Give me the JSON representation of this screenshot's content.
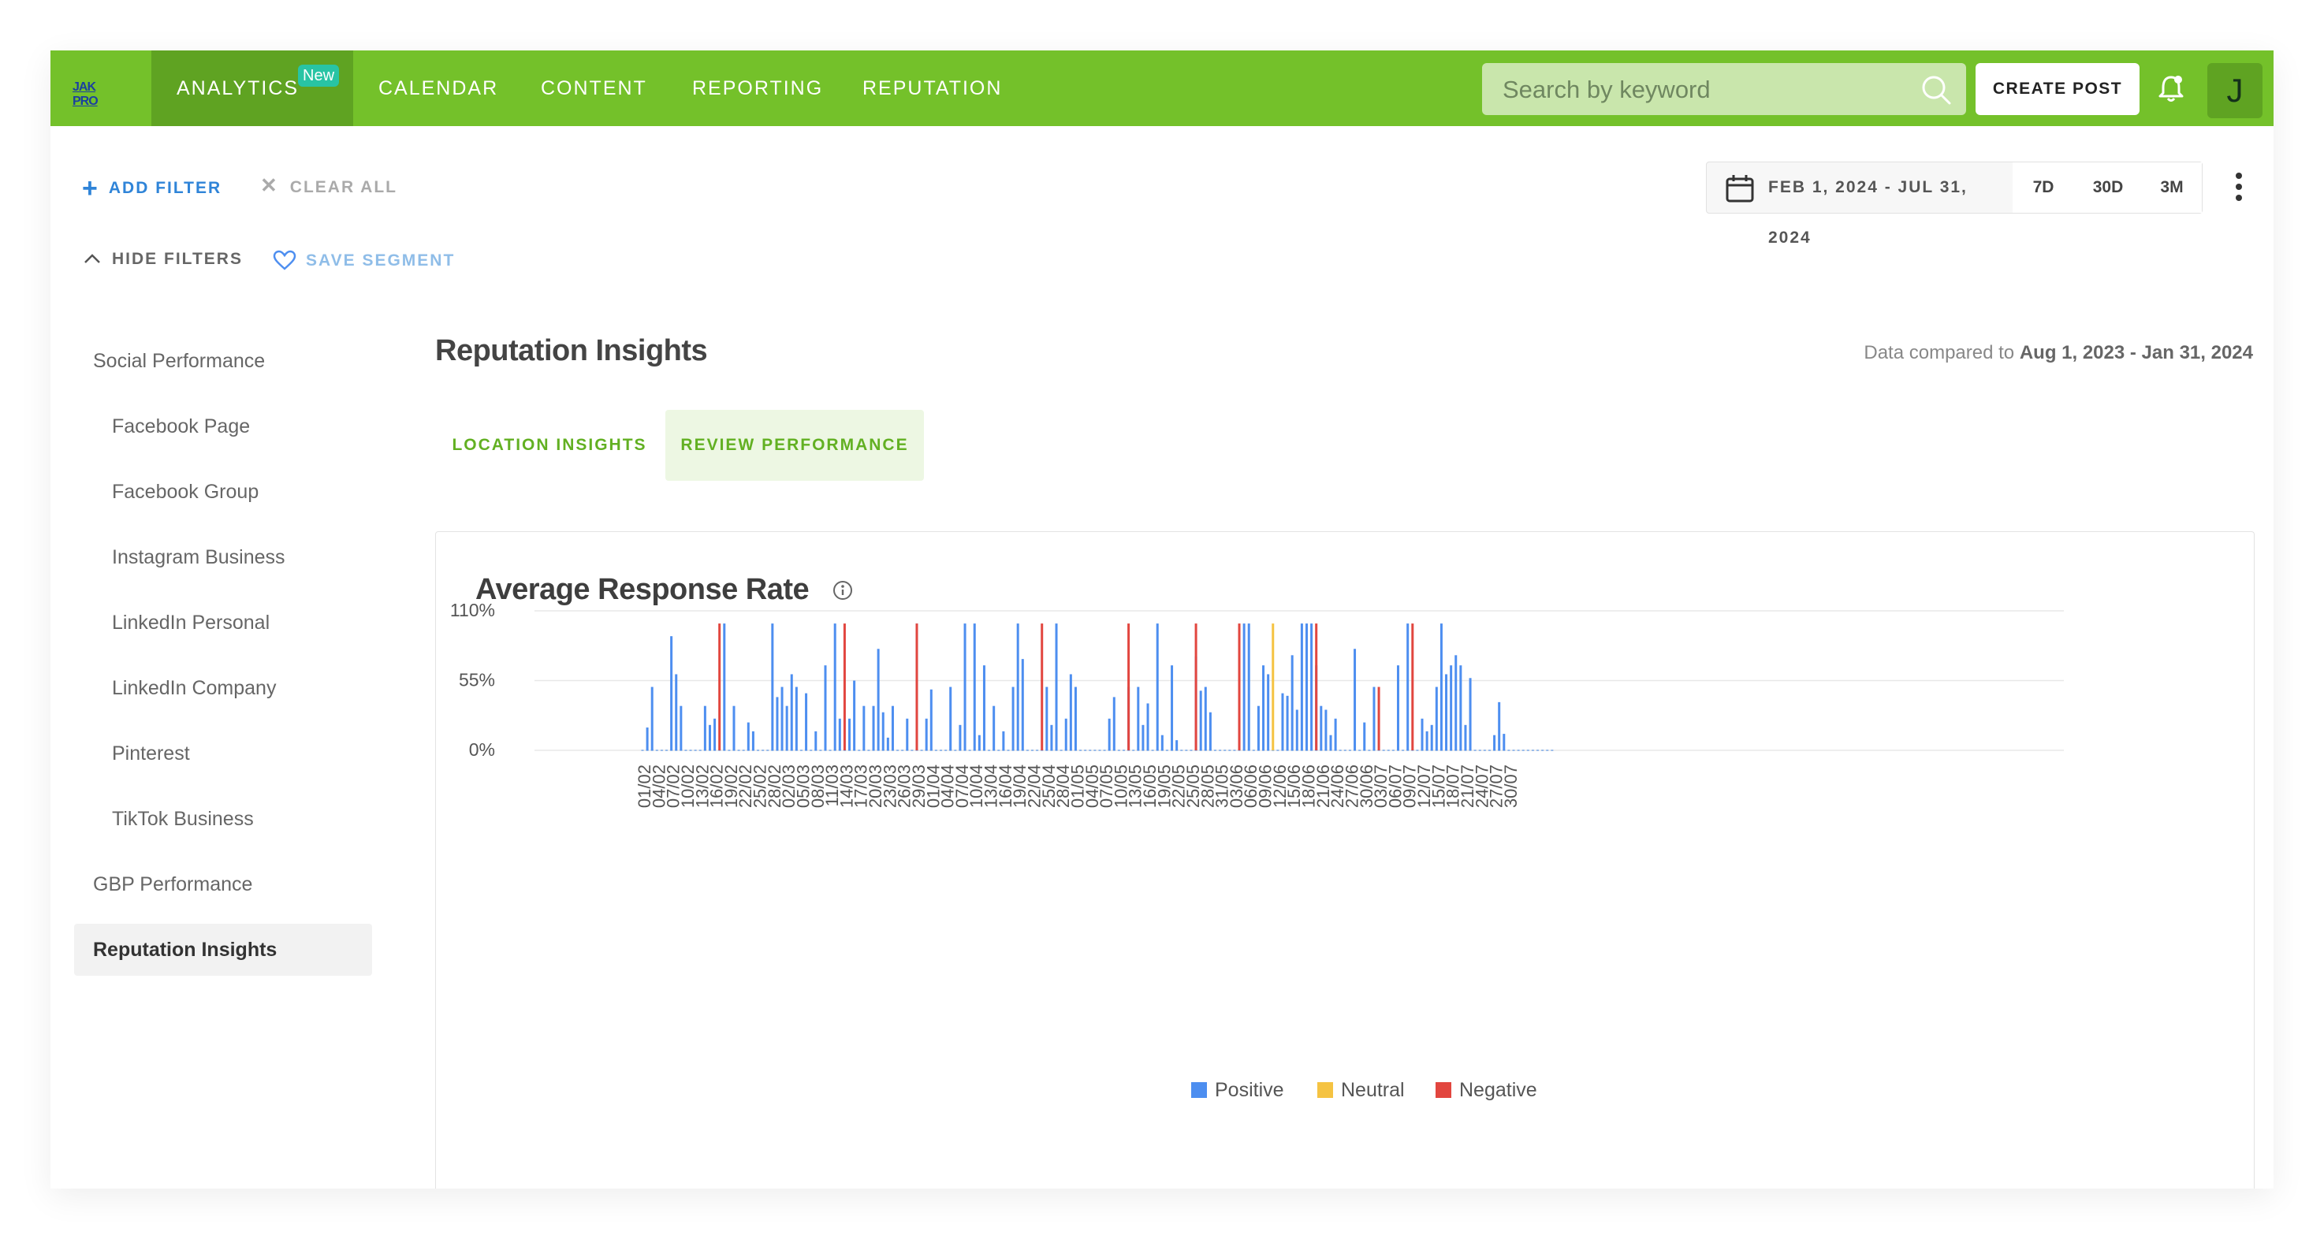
{
  "brand": {
    "logo_text": "JAK PRO"
  },
  "nav": {
    "items": [
      {
        "label": "ANALYTICS",
        "badge": "New",
        "active": true
      },
      {
        "label": "CALENDAR"
      },
      {
        "label": "CONTENT"
      },
      {
        "label": "REPORTING"
      },
      {
        "label": "REPUTATION"
      }
    ],
    "search_placeholder": "Search by keyword",
    "create_post_label": "CREATE POST",
    "avatar_initial": "J"
  },
  "filters": {
    "add_filter": "ADD FILTER",
    "clear_all": "CLEAR ALL",
    "hide_filters": "HIDE FILTERS",
    "save_segment": "SAVE SEGMENT",
    "date_range": "FEB 1, 2024 - JUL 31, 2024",
    "presets": [
      "7D",
      "30D",
      "3M"
    ]
  },
  "sidebar": {
    "items": [
      {
        "label": "Social Performance",
        "level": 0
      },
      {
        "label": "Facebook Page",
        "level": 1
      },
      {
        "label": "Facebook Group",
        "level": 1
      },
      {
        "label": "Instagram Business",
        "level": 1
      },
      {
        "label": "LinkedIn Personal",
        "level": 1
      },
      {
        "label": "LinkedIn Company",
        "level": 1
      },
      {
        "label": "Pinterest",
        "level": 1
      },
      {
        "label": "TikTok Business",
        "level": 1
      },
      {
        "label": "GBP Performance",
        "level": 0
      },
      {
        "label": "Reputation Insights",
        "level": 0,
        "active": true
      }
    ]
  },
  "main": {
    "title": "Reputation Insights",
    "compare_prefix": "Data compared to",
    "compare_range": "Aug 1, 2023 - Jan 31, 2024",
    "tabs": [
      {
        "label": "LOCATION INSIGHTS"
      },
      {
        "label": "REVIEW PERFORMANCE",
        "active": true
      }
    ],
    "card_title": "Average Response Rate"
  },
  "colors": {
    "brand_green": "#74c12a",
    "positive": "#4d8ef0",
    "neutral": "#f5c342",
    "negative": "#e2463f"
  },
  "chart_data": {
    "type": "bar",
    "title": "Average Response Rate",
    "ylabel": "",
    "ylim": [
      0,
      110
    ],
    "y_ticks": [
      "0%",
      "55%",
      "110%"
    ],
    "y_tick_values": [
      0,
      55,
      110
    ],
    "x_tick_labels": [
      "01/02",
      "04/02",
      "07/02",
      "10/02",
      "13/02",
      "16/02",
      "19/02",
      "22/02",
      "25/02",
      "28/02",
      "02/03",
      "05/03",
      "08/03",
      "11/03",
      "14/03",
      "17/03",
      "20/03",
      "23/03",
      "26/03",
      "29/03",
      "01/04",
      "04/04",
      "07/04",
      "10/04",
      "13/04",
      "16/04",
      "19/04",
      "22/04",
      "25/04",
      "28/04",
      "01/05",
      "04/05",
      "07/05",
      "10/05",
      "13/05",
      "16/05",
      "19/05",
      "22/05",
      "25/05",
      "28/05",
      "31/05",
      "03/06",
      "06/06",
      "09/06",
      "12/06",
      "15/06",
      "18/06",
      "21/06",
      "24/06",
      "27/06",
      "30/06",
      "03/07",
      "06/07",
      "09/07",
      "12/07",
      "15/07",
      "18/07",
      "21/07",
      "24/07",
      "27/07",
      "30/07"
    ],
    "legend": [
      "Positive",
      "Neutral",
      "Negative"
    ],
    "legend_position": "bottom",
    "grid": true,
    "series": [
      {
        "name": "Positive",
        "points": [
          [
            1,
            18
          ],
          [
            2,
            50
          ],
          [
            6,
            90
          ],
          [
            7,
            60
          ],
          [
            8,
            35
          ],
          [
            13,
            35
          ],
          [
            14,
            20
          ],
          [
            15,
            25
          ],
          [
            17,
            100
          ],
          [
            19,
            35
          ],
          [
            22,
            22
          ],
          [
            23,
            15
          ],
          [
            27,
            100
          ],
          [
            28,
            42
          ],
          [
            29,
            50
          ],
          [
            30,
            35
          ],
          [
            31,
            60
          ],
          [
            32,
            50
          ],
          [
            34,
            45
          ],
          [
            36,
            15
          ],
          [
            38,
            67
          ],
          [
            40,
            100
          ],
          [
            41,
            25
          ],
          [
            43,
            25
          ],
          [
            44,
            55
          ],
          [
            46,
            35
          ],
          [
            48,
            35
          ],
          [
            49,
            80
          ],
          [
            50,
            30
          ],
          [
            51,
            10
          ],
          [
            52,
            35
          ],
          [
            55,
            25
          ],
          [
            57,
            100
          ],
          [
            59,
            25
          ],
          [
            60,
            48
          ],
          [
            64,
            50
          ],
          [
            66,
            20
          ],
          [
            67,
            100
          ],
          [
            69,
            100
          ],
          [
            70,
            12
          ],
          [
            71,
            67
          ],
          [
            73,
            35
          ],
          [
            75,
            15
          ],
          [
            77,
            50
          ],
          [
            78,
            100
          ],
          [
            79,
            72
          ],
          [
            84,
            50
          ],
          [
            85,
            20
          ],
          [
            86,
            100
          ],
          [
            88,
            25
          ],
          [
            89,
            60
          ],
          [
            90,
            50
          ],
          [
            97,
            25
          ],
          [
            98,
            42
          ],
          [
            101,
            50
          ],
          [
            103,
            50
          ],
          [
            104,
            20
          ],
          [
            105,
            37
          ],
          [
            107,
            100
          ],
          [
            108,
            12
          ],
          [
            110,
            67
          ],
          [
            111,
            8
          ],
          [
            115,
            74
          ],
          [
            116,
            47
          ],
          [
            117,
            50
          ],
          [
            118,
            30
          ],
          [
            124,
            25
          ],
          [
            125,
            100
          ],
          [
            126,
            100
          ],
          [
            128,
            35
          ],
          [
            129,
            67
          ],
          [
            130,
            60
          ],
          [
            133,
            45
          ],
          [
            134,
            43
          ],
          [
            135,
            75
          ],
          [
            136,
            32
          ],
          [
            137,
            100
          ],
          [
            138,
            100
          ],
          [
            139,
            100
          ],
          [
            140,
            67
          ],
          [
            141,
            35
          ],
          [
            142,
            32
          ],
          [
            143,
            12
          ],
          [
            144,
            25
          ],
          [
            148,
            80
          ],
          [
            150,
            22
          ],
          [
            152,
            50
          ],
          [
            157,
            67
          ],
          [
            159,
            100
          ],
          [
            162,
            25
          ],
          [
            163,
            15
          ],
          [
            164,
            20
          ],
          [
            165,
            50
          ],
          [
            166,
            100
          ],
          [
            167,
            60
          ],
          [
            168,
            67
          ],
          [
            169,
            75
          ],
          [
            170,
            67
          ],
          [
            171,
            20
          ],
          [
            172,
            57
          ],
          [
            177,
            12
          ],
          [
            178,
            38
          ],
          [
            179,
            13
          ]
        ]
      },
      {
        "name": "Neutral",
        "points": [
          [
            131,
            100
          ]
        ]
      },
      {
        "name": "Negative",
        "points": [
          [
            16,
            100
          ],
          [
            42,
            100
          ],
          [
            57,
            100
          ],
          [
            83,
            100
          ],
          [
            101,
            100
          ],
          [
            115,
            100
          ],
          [
            124,
            100
          ],
          [
            140,
            100
          ],
          [
            153,
            50
          ],
          [
            160,
            100
          ]
        ]
      }
    ]
  }
}
